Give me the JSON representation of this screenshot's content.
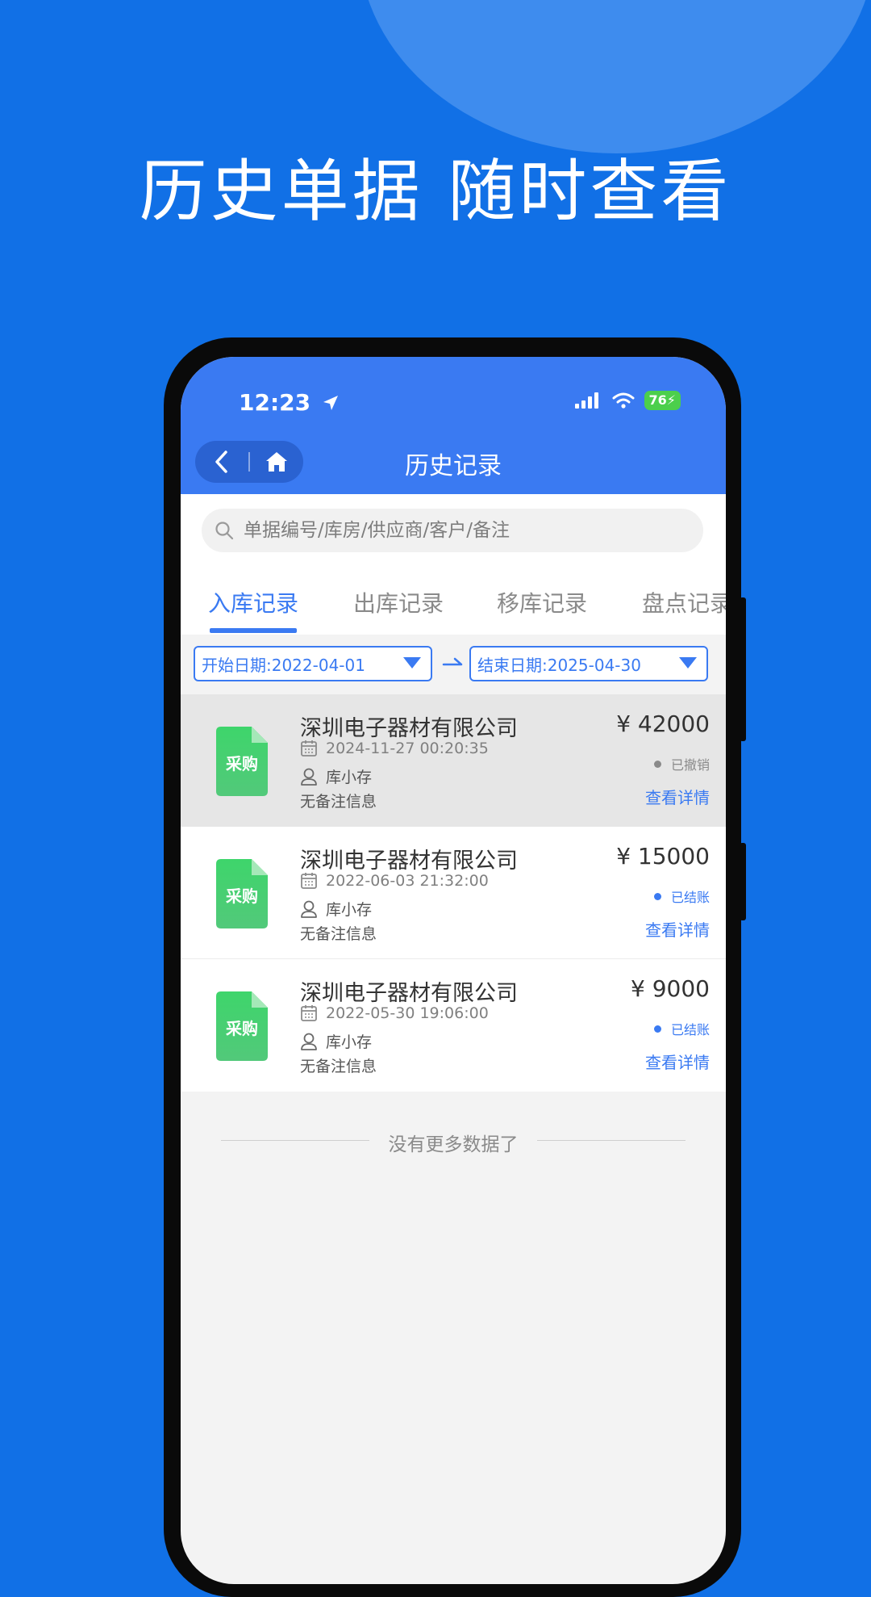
{
  "promo": {
    "headline": "历史单据 随时查看"
  },
  "status_bar": {
    "time": "12:23",
    "battery": "76"
  },
  "header": {
    "title": "历史记录",
    "back_icon": "chevron-left-icon",
    "home_icon": "home-icon"
  },
  "search": {
    "placeholder": "单据编号/库房/供应商/客户/备注"
  },
  "tabs": [
    {
      "label": "入库记录",
      "active": true
    },
    {
      "label": "出库记录",
      "active": false
    },
    {
      "label": "移库记录",
      "active": false
    },
    {
      "label": "盘点记录",
      "active": false
    }
  ],
  "filters": {
    "start": "开始日期:2022-04-01",
    "end": "结束日期:2025-04-30"
  },
  "records": [
    {
      "type_badge": "采购",
      "company": "深圳电子器材有限公司",
      "datetime": "2024-11-27 00:20:35",
      "operator": "库小存",
      "remark": "无备注信息",
      "amount": "¥ 42000",
      "status": "已撤销",
      "status_color": "#8a8a8a",
      "detail": "查看详情",
      "selected": true
    },
    {
      "type_badge": "采购",
      "company": "深圳电子器材有限公司",
      "datetime": "2022-06-03 21:32:00",
      "operator": "库小存",
      "remark": "无备注信息",
      "amount": "¥ 15000",
      "status": "已结账",
      "status_color": "#3a7af2",
      "detail": "查看详情",
      "selected": false
    },
    {
      "type_badge": "采购",
      "company": "深圳电子器材有限公司",
      "datetime": "2022-05-30 19:06:00",
      "operator": "库小存",
      "remark": "无备注信息",
      "amount": "¥ 9000",
      "status": "已结账",
      "status_color": "#3a7af2",
      "detail": "查看详情",
      "selected": false
    }
  ],
  "list_footer": "没有更多数据了",
  "colors": {
    "brand_bg": "#1170e6",
    "app_blue": "#3a7af2",
    "doc_green": "#3fcf6a"
  }
}
